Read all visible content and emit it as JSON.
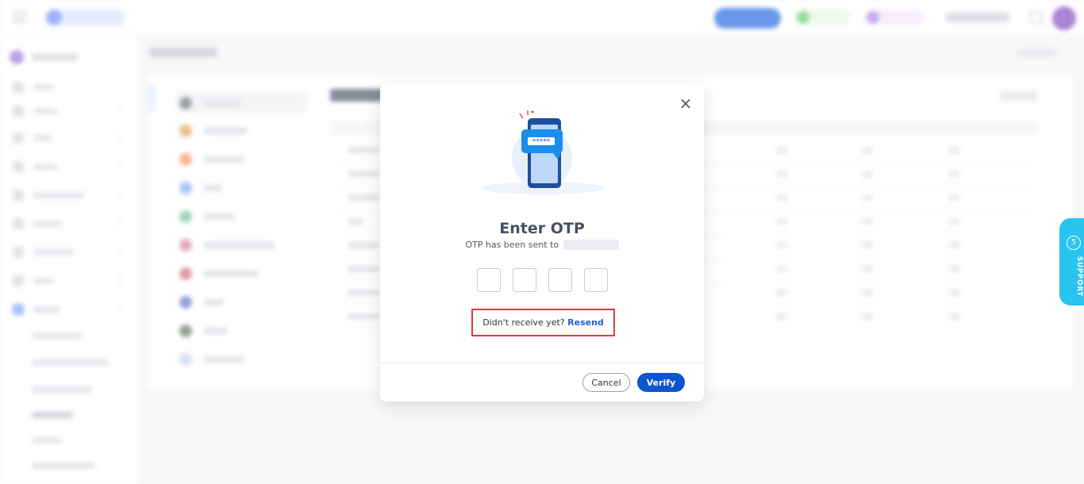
{
  "modal": {
    "title": "Enter OTP",
    "subtitle": "OTP has been sent to",
    "otp_digit_count": 4,
    "resend_prompt": "Didn't receive yet?",
    "resend_link": "Resend",
    "cancel_label": "Cancel",
    "verify_label": "Verify",
    "close_glyph": "×"
  },
  "support": {
    "count": "5",
    "label": "SUPPORT"
  },
  "colors": {
    "primary": "#0b55d0",
    "link": "#1f5fd1",
    "highlight_border": "#e0393e",
    "support_tab": "#29c3f0"
  }
}
